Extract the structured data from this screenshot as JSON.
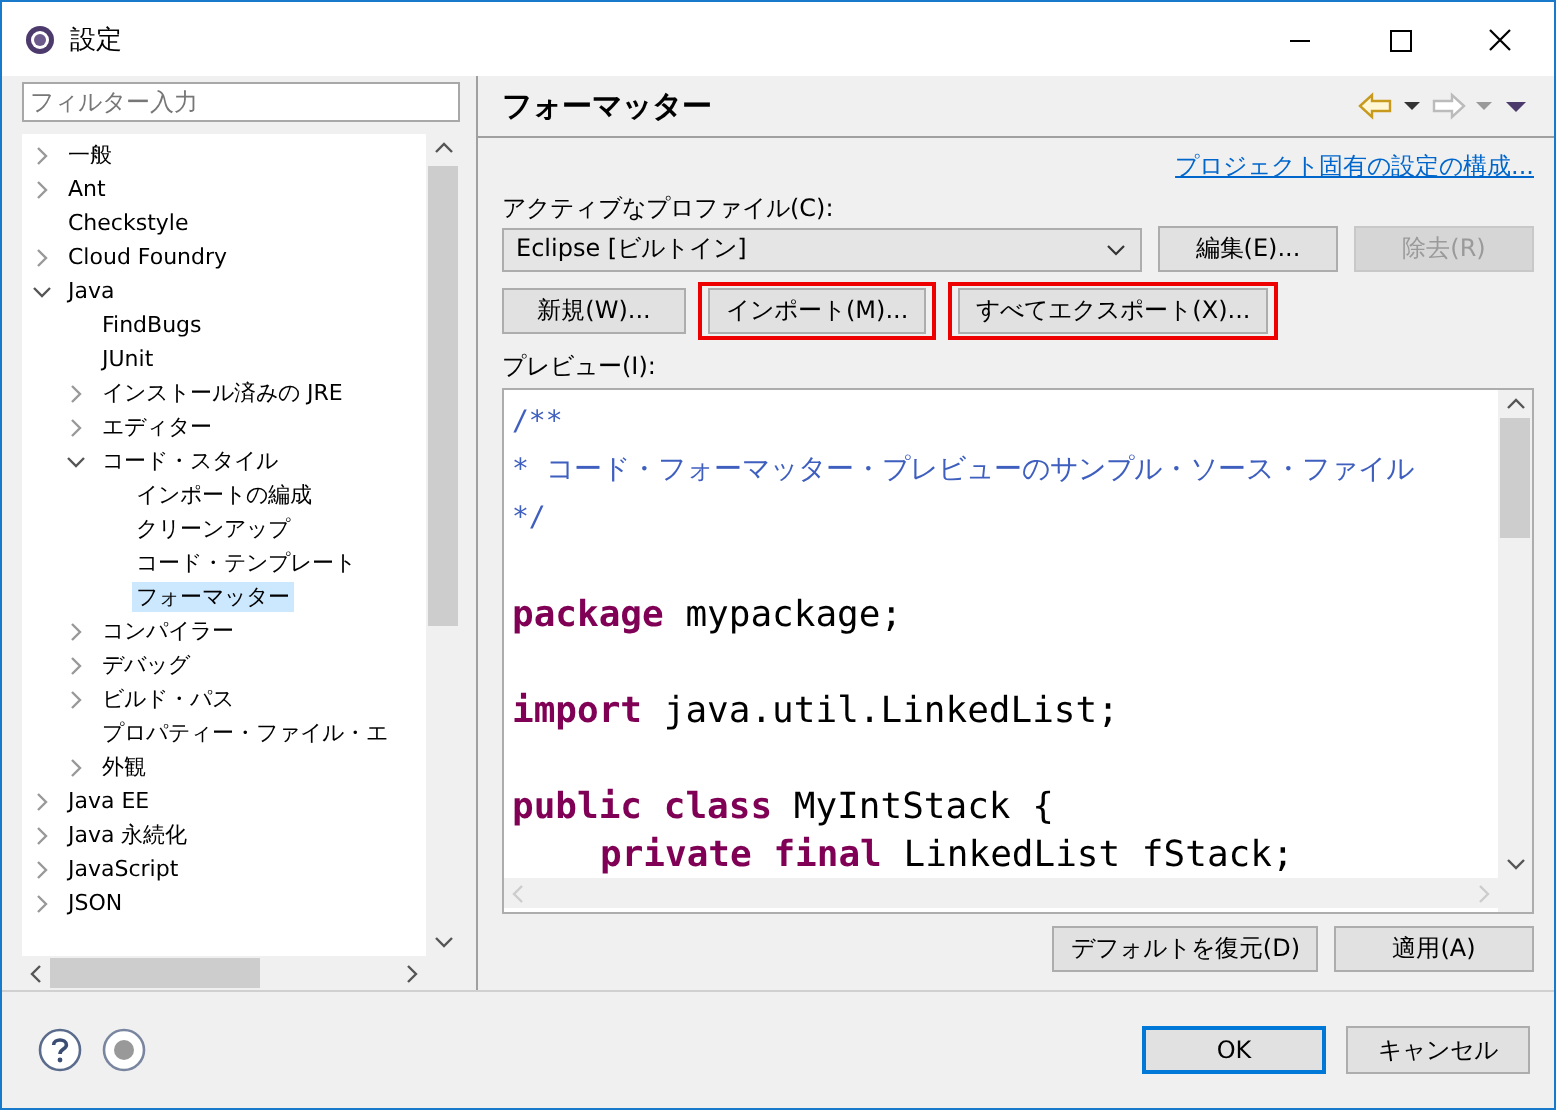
{
  "window": {
    "title": "設定"
  },
  "sidebar": {
    "filter": {
      "placeholder": "フィルター入力"
    },
    "tree": [
      {
        "label": "一般",
        "kind": "folder",
        "expanded": false,
        "selected": false
      },
      {
        "label": "Ant",
        "kind": "folder",
        "expanded": false,
        "selected": false
      },
      {
        "label": "Checkstyle",
        "kind": "leaf",
        "selected": false
      },
      {
        "label": "Cloud Foundry",
        "kind": "folder",
        "expanded": false,
        "selected": false
      },
      {
        "label": "Java",
        "kind": "folder",
        "expanded": true,
        "selected": false,
        "children": [
          {
            "label": "FindBugs",
            "kind": "leaf",
            "selected": false
          },
          {
            "label": "JUnit",
            "kind": "leaf",
            "selected": false
          },
          {
            "label": "インストール済みの JRE",
            "kind": "folder",
            "expanded": false,
            "selected": false
          },
          {
            "label": "エディター",
            "kind": "folder",
            "expanded": false,
            "selected": false
          },
          {
            "label": "コード・スタイル",
            "kind": "folder",
            "expanded": true,
            "selected": false,
            "children": [
              {
                "label": "インポートの編成",
                "kind": "leaf",
                "selected": false
              },
              {
                "label": "クリーンアップ",
                "kind": "leaf",
                "selected": false
              },
              {
                "label": "コード・テンプレート",
                "kind": "leaf",
                "selected": false
              },
              {
                "label": "フォーマッター",
                "kind": "leaf",
                "selected": true
              }
            ]
          },
          {
            "label": "コンパイラー",
            "kind": "folder",
            "expanded": false,
            "selected": false
          },
          {
            "label": "デバッグ",
            "kind": "folder",
            "expanded": false,
            "selected": false
          },
          {
            "label": "ビルド・パス",
            "kind": "folder",
            "expanded": false,
            "selected": false
          },
          {
            "label": "プロパティー・ファイル・エ",
            "kind": "leaf",
            "selected": false
          },
          {
            "label": "外観",
            "kind": "folder",
            "expanded": false,
            "selected": false
          }
        ]
      },
      {
        "label": "Java EE",
        "kind": "folder",
        "expanded": false,
        "selected": false
      },
      {
        "label": "Java 永続化",
        "kind": "folder",
        "expanded": false,
        "selected": false
      },
      {
        "label": "JavaScript",
        "kind": "folder",
        "expanded": false,
        "selected": false
      },
      {
        "label": "JSON",
        "kind": "folder",
        "expanded": false,
        "selected": false
      }
    ]
  },
  "page": {
    "title": "フォーマッター",
    "link": "プロジェクト固有の設定の構成...",
    "profile_label": "アクティブなプロファイル(C):",
    "profile": {
      "value": "Eclipse [ビルトイン]"
    },
    "profile_buttons": [
      {
        "label": "編集(E)...",
        "disabled": false,
        "highlighted": false
      },
      {
        "label": "除去(R)",
        "disabled": true,
        "highlighted": false
      }
    ],
    "action_buttons": [
      {
        "label": "新規(W)...",
        "disabled": false,
        "highlighted": false
      },
      {
        "label": "インポート(M)...",
        "disabled": false,
        "highlighted": true
      },
      {
        "label": "すべてエクスポート(X)...",
        "disabled": false,
        "highlighted": true
      }
    ],
    "preview_label": "プレビュー(I):",
    "code": [
      {
        "kind": "code",
        "indented": false,
        "tokens": [
          {
            "kind": "comment",
            "text": "/**"
          }
        ]
      },
      {
        "kind": "code",
        "indented": false,
        "tokens": [
          {
            "kind": "comment",
            "text": "* コード・フォーマッター・プレビューのサンプル・ソース・ファイル"
          }
        ]
      },
      {
        "kind": "code",
        "indented": false,
        "tokens": [
          {
            "kind": "comment",
            "text": "*/"
          }
        ]
      },
      {
        "kind": "blank"
      },
      {
        "kind": "code",
        "indented": false,
        "tokens": [
          {
            "kind": "keyword",
            "text": "package"
          },
          {
            "kind": "plain",
            "text": " mypackage;"
          }
        ]
      },
      {
        "kind": "blank"
      },
      {
        "kind": "code",
        "indented": false,
        "tokens": [
          {
            "kind": "keyword",
            "text": "import"
          },
          {
            "kind": "plain",
            "text": " java.util.LinkedList;"
          }
        ]
      },
      {
        "kind": "blank"
      },
      {
        "kind": "code",
        "indented": false,
        "tokens": [
          {
            "kind": "keyword",
            "text": "public class"
          },
          {
            "kind": "plain",
            "text": " MyIntStack {"
          }
        ]
      },
      {
        "kind": "code",
        "indented": true,
        "tokens": [
          {
            "kind": "keyword",
            "text": "private final"
          },
          {
            "kind": "plain",
            "text": " LinkedList fStack;"
          }
        ]
      }
    ],
    "page_buttons": [
      {
        "label": "デフォルトを復元(D)",
        "disabled": false
      },
      {
        "label": "適用(A)",
        "disabled": false
      }
    ]
  },
  "dialog_buttons": [
    {
      "label": "OK",
      "default": true
    },
    {
      "label": "キャンセル",
      "default": false
    }
  ]
}
